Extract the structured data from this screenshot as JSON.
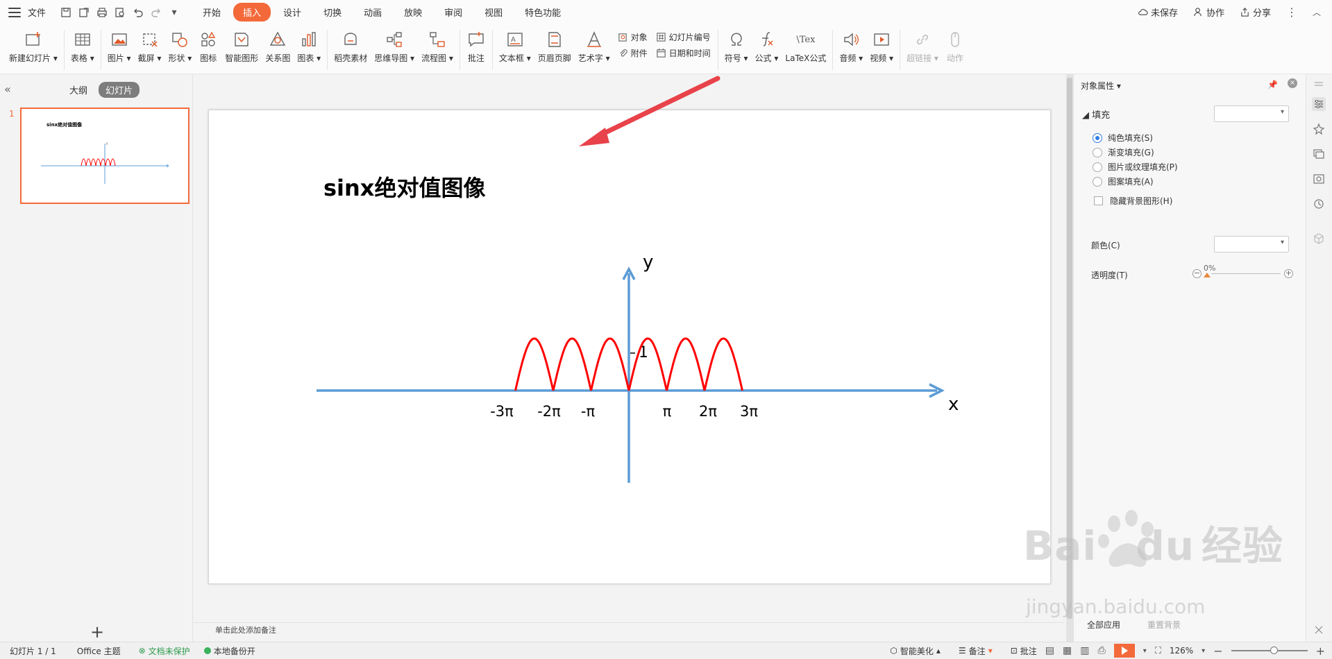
{
  "menubar": {
    "file": "文件",
    "tabs": [
      "开始",
      "插入",
      "设计",
      "切换",
      "动画",
      "放映",
      "审阅",
      "视图",
      "特色功能"
    ],
    "active_tab": "插入",
    "unsaved": "未保存",
    "collab": "协作",
    "share": "分享"
  },
  "ribbon": {
    "new_slide": "新建幻灯片",
    "table": "表格",
    "picture": "图片",
    "screenshot": "截屏",
    "shape": "形状",
    "icon": "图标",
    "smart_shape": "智能图形",
    "relation": "关系图",
    "chart": "图表",
    "material": "稻壳素材",
    "mindmap": "思维导图",
    "flowchart": "流程图",
    "comment": "批注",
    "textbox": "文本框",
    "header_footer": "页眉页脚",
    "wordart": "艺术字",
    "object": "对象",
    "attachment": "附件",
    "slide_number": "幻灯片编号",
    "date_time": "日期和时间",
    "symbol": "符号",
    "formula": "公式",
    "latex": "LaTeX公式",
    "audio": "音频",
    "video": "视频",
    "hyperlink": "超链接",
    "action": "动作",
    "latex_icon_text": "\\Tex"
  },
  "leftpanel": {
    "tab_outline": "大纲",
    "tab_slides": "幻灯片",
    "slide_number": "1",
    "thumb_title": "sinx绝对值图像",
    "add": "+"
  },
  "slide": {
    "title": "sinx绝对值图像",
    "y_label": "y",
    "x_label": "x",
    "one_label": "1",
    "ticks": [
      "-3π",
      "-2π",
      "-π",
      "π",
      "2π",
      "3π"
    ]
  },
  "chart_data": {
    "type": "line",
    "title": "sinx绝对值图像",
    "xlabel": "x",
    "ylabel": "y",
    "x_tick_labels": [
      "-3π",
      "-2π",
      "-π",
      "π",
      "2π",
      "3π"
    ],
    "xlim": [
      -3.14159,
      3.14159
    ],
    "y_tick_labels": [
      "1"
    ],
    "series": [
      {
        "color": "#ff0000",
        "x_range": [
          -9.42478,
          9.42478
        ],
        "values_description_points": [
          [
            -9.42478,
            0
          ],
          [
            -7.85398,
            1
          ],
          [
            -6.28319,
            0
          ],
          [
            -4.71239,
            1
          ],
          [
            -3.14159,
            0
          ],
          [
            -1.5708,
            1
          ],
          [
            0,
            0
          ],
          [
            1.5708,
            1
          ],
          [
            3.14159,
            0
          ],
          [
            4.71239,
            1
          ],
          [
            6.28319,
            0
          ],
          [
            7.85398,
            1
          ],
          [
            9.42478,
            0
          ]
        ]
      }
    ],
    "axis_color": "#5b9bd5"
  },
  "notes": {
    "placeholder": "单击此处添加备注"
  },
  "rpanel": {
    "title": "对象属性",
    "fill_section": "填充",
    "radio_solid": "纯色填充(S)",
    "radio_gradient": "渐变填充(G)",
    "radio_picture": "图片或纹理填充(P)",
    "radio_pattern": "图案填充(A)",
    "hide_bg": "隐藏背景图形(H)",
    "color": "颜色(C)",
    "transparency": "透明度(T)",
    "transparency_value": "0%",
    "apply_all": "全部应用",
    "reset_bg": "重置背景"
  },
  "statusbar": {
    "slide_count": "幻灯片 1 / 1",
    "theme": "Office 主题",
    "doc_protect": "文档未保护",
    "backup": "本地备份开",
    "beautify": "智能美化",
    "notes": "备注",
    "comment": "批注",
    "zoom": "126%"
  },
  "watermark": {
    "brand": "Bai",
    "brand2": "du",
    "brand_cn": "经验",
    "url": "jingyan.baidu.com"
  },
  "colors": {
    "accent": "#f4693a",
    "curve": "#ff0000",
    "axis": "#5b9bd5",
    "arrow": "#e8424a"
  }
}
